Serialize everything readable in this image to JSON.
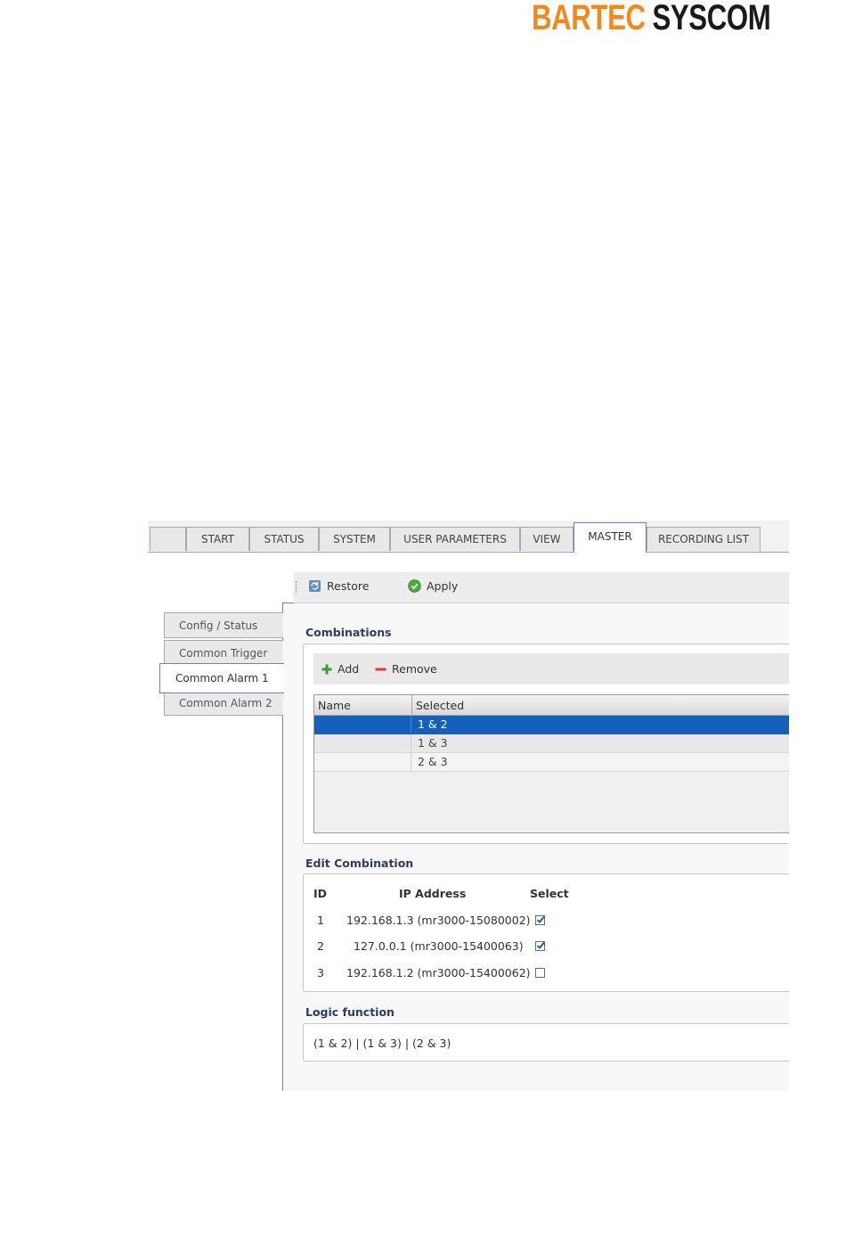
{
  "brand": {
    "part1": "BARTEC",
    "part2": "SYSCOM"
  },
  "tabs": [
    {
      "label": ""
    },
    {
      "label": "START"
    },
    {
      "label": "STATUS"
    },
    {
      "label": "SYSTEM"
    },
    {
      "label": "USER PARAMETERS"
    },
    {
      "label": "VIEW"
    },
    {
      "label": "MASTER",
      "active": true
    },
    {
      "label": "RECORDING LIST"
    }
  ],
  "toolbar": {
    "restore_label": "Restore",
    "apply_label": "Apply"
  },
  "sidebar": {
    "items": [
      {
        "label": "Config / Status"
      },
      {
        "label": "Common Trigger"
      },
      {
        "label": "Common Alarm 1",
        "active": true
      },
      {
        "label": "Common Alarm 2"
      }
    ]
  },
  "combinations": {
    "title": "Combinations",
    "add_label": "Add",
    "remove_label": "Remove",
    "columns": [
      "Name",
      "Selected"
    ],
    "rows": [
      {
        "name": "",
        "selected": "1 & 2",
        "highlighted": true
      },
      {
        "name": "",
        "selected": "1 & 3"
      },
      {
        "name": "",
        "selected": "2 & 3"
      }
    ]
  },
  "edit_combination": {
    "title": "Edit Combination",
    "columns": [
      "ID",
      "IP Address",
      "Select"
    ],
    "rows": [
      {
        "id": "1",
        "ip": "192.168.1.3 (mr3000-15080002)",
        "checked": true
      },
      {
        "id": "2",
        "ip": "127.0.0.1 (mr3000-15400063)",
        "checked": true
      },
      {
        "id": "3",
        "ip": "192.168.1.2 (mr3000-15400062)",
        "checked": false
      }
    ]
  },
  "logic_function": {
    "title": "Logic function",
    "value": "(1 & 2) | (1 & 3) | (2 & 3)"
  },
  "colors": {
    "brand_orange": "#f08a1c",
    "brand_dark": "#1a1a1a",
    "selection_blue": "#1560bd",
    "section_title": "#2c3f5f"
  }
}
